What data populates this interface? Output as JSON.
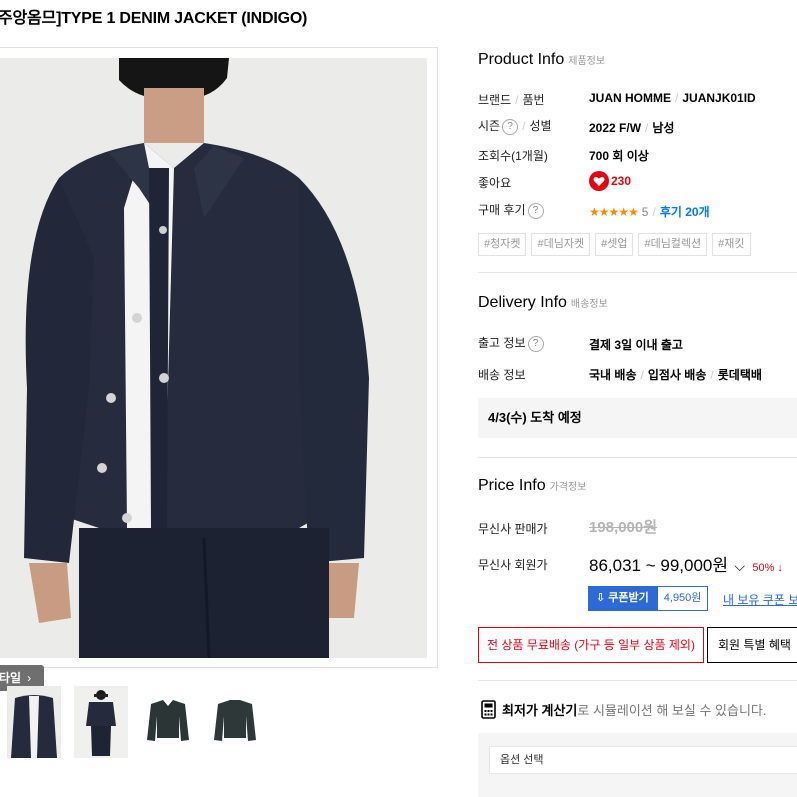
{
  "product": {
    "title": "주앙옴므]TYPE 1 DENIM JACKET (INDIGO)"
  },
  "gallery": {
    "style_button": "타일",
    "thumbnails": [
      "model-front",
      "model-full",
      "jacket-front",
      "jacket-back"
    ]
  },
  "product_info": {
    "heading": "Product Info",
    "heading_sub": "제품정보",
    "rows": {
      "brand_label": "브랜드",
      "code_label": "품번",
      "brand": "JUAN HOMME",
      "code": "JUANJK01ID",
      "season_label": "시즌",
      "gender_label": "성별",
      "season": "2022 F/W",
      "gender": "남성",
      "views_label": "조회수(1개월)",
      "views": "700 회 이상",
      "likes_label": "좋아요",
      "likes": "230",
      "review_label": "구매 후기",
      "stars": "★★★★★",
      "score": "5",
      "review_link": "후기 20개"
    },
    "tags": [
      "#청자켓",
      "#데님자켓",
      "#셋업",
      "#데님컬렉션",
      "#재킷"
    ]
  },
  "delivery_info": {
    "heading": "Delivery Info",
    "heading_sub": "배송정보",
    "ship_label": "출고 정보",
    "ship_value": "결제 3일 이내 출고",
    "method_label": "배송 정보",
    "method_1": "국내 배송",
    "method_2": "입점사 배송",
    "method_3": "롯데택배",
    "arrival": "4/3(수) 도착 예정"
  },
  "price_info": {
    "heading": "Price Info",
    "heading_sub": "가격정보",
    "sale_label": "무신사 판매가",
    "sale_price": "198,000원",
    "member_label": "무신사 회원가",
    "member_price": "86,031 ~ 99,000원",
    "discount": "50% ↓",
    "coupon_button": "쿠폰받기",
    "coupon_amount": "4,950원",
    "my_coupon_link": "내 보유 쿠폰 보"
  },
  "benefits": {
    "free_shipping": "전 상품 무료배송 (가구 등 일부 상품 제외)",
    "member_benefit": "회원 특별 혜택"
  },
  "calculator": {
    "title": "최저가 계산기",
    "desc": "로 시뮬레이션 해 보실 수 있습니다."
  },
  "option": {
    "placeholder": "옵션 선택"
  },
  "colors": {
    "accent_red": "#e60012",
    "accent_blue": "#2d6ad6",
    "link_blue": "#0078ff",
    "star": "#ff8a00"
  }
}
